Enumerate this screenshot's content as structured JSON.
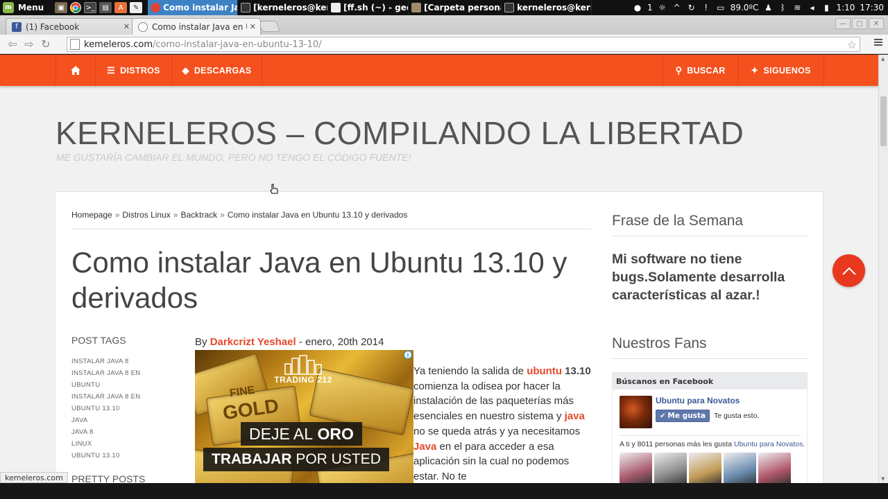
{
  "panel": {
    "menu_label": "Menu",
    "tasks": [
      {
        "label": "Como instalar Jav..."
      },
      {
        "label": "[kerneleros@kern..."
      },
      {
        "label": "[ff.sh (~) - gedit]"
      },
      {
        "label": "[Carpeta personal]"
      },
      {
        "label": "kerneleros@kern..."
      }
    ],
    "notif_count": "1",
    "temperature": "89.0ºC",
    "time_left": "1:10",
    "clock": "17:30"
  },
  "browser": {
    "tabs": [
      {
        "title": "(1) Facebook",
        "icon": "facebook-icon"
      },
      {
        "title": "Como instalar Java en U",
        "icon": "chrome-page-icon"
      }
    ],
    "url_host": "kemeleros.com",
    "url_path": "/como-instalar-java-en-ubuntu-13-10/"
  },
  "site": {
    "nav": {
      "home_icon": "home-icon",
      "distros": "DISTROS",
      "descargas": "DESCARGAS",
      "buscar": "BUSCAR",
      "siguenos": "SIGUENOS"
    },
    "title": "KERNELEROS – COMPILANDO LA LIBERTAD",
    "tagline": "ME GUSTARÍA CAMBIAR EL MUNDO, PERO NO TENGO EL CÓDIGO FUENTE!"
  },
  "post": {
    "breadcrumb": [
      "Homepage",
      "Distros Linux",
      "Backtrack",
      "Como instalar Java en Ubuntu 13.10 y derivados"
    ],
    "breadcrumb_sep": "»",
    "title": "Como instalar Java en Ubuntu 13.10 y derivados",
    "tags_title": "POST TAGS",
    "tags": [
      "INSTALAR JAVA 8",
      "INSTALAR JAVA 8 EN",
      "UBUNTU",
      "INSTALAR JAVA 8 EN",
      "UBUNTU 13.10",
      "JAVA",
      "JAVA 8",
      "LINUX",
      "UBUNTU 13.10"
    ],
    "pretty_posts": "PRETTY POSTS",
    "byline_prefix": "By",
    "author": "Darkcrizt Yeshael",
    "date": "- enero, 20th 2014",
    "body": {
      "p1": "Ya teniendo la salida de",
      "ubuntu": "ubuntu",
      "version": "13.10",
      "p2": "comienza la odisea por hacer la instalación de las paqueterías más esenciales en nuestro sistema y",
      "java1": "java",
      "p3": "no se queda atrás y ya necesitamos",
      "java2": "Java",
      "p4": "en el para acceder a esa aplicación sin la cual no podemos estar. No te"
    }
  },
  "ad": {
    "brand": "TRADING 212",
    "fine": "FINE",
    "gold": "GOLD",
    "line1_a": "DEJE AL",
    "line1_b": "ORO",
    "line2_a": "TRABAJAR",
    "line2_b": "POR USTED"
  },
  "sidebar": {
    "phrase_title": "Frase de la Semana",
    "phrase": "Mi software no tiene bugs.Solamente desarrolla características al azar.!",
    "fans_title": "Nuestros Fans",
    "fb": {
      "header": "Búscanos en Facebook",
      "page_name": "Ubuntu para Novatos",
      "like_btn": "Me gusta",
      "like_text": "Te gusta esto.",
      "fans_text": "A ti y 8011 personas más les gusta",
      "fans_link": "Ubuntu para Novatos",
      "face_colors": [
        "#a95b6e",
        "#8c8c8c",
        "#c29b56",
        "#6b8db0",
        "#b0566a"
      ]
    }
  },
  "status": {
    "link": "kemeleros.com"
  },
  "colors": {
    "accent": "#f4511e",
    "link": "#e4492b",
    "fb_blue": "#3b5998"
  }
}
